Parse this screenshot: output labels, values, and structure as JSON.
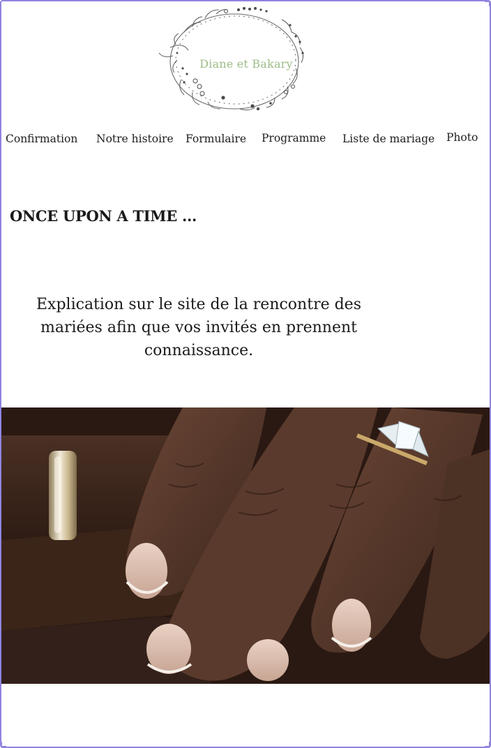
{
  "logo": {
    "text": "Diane et Bakary"
  },
  "nav": {
    "items": [
      {
        "label": "Confirmation"
      },
      {
        "label": "Notre histoire"
      },
      {
        "label": "Formulaire"
      },
      {
        "label": "Programme"
      },
      {
        "label": "Liste de mariage"
      },
      {
        "label": "Photo"
      }
    ]
  },
  "main": {
    "heading": "ONCE UPON A TIME ...",
    "explanation": "Explication sur le site de la rencontre des mariées afin que vos invités en prennent connaissance."
  },
  "colors": {
    "frame": "#8f84e0",
    "logo_text": "#9cbc86"
  },
  "icons": [
    "floral-wreath-icon"
  ]
}
